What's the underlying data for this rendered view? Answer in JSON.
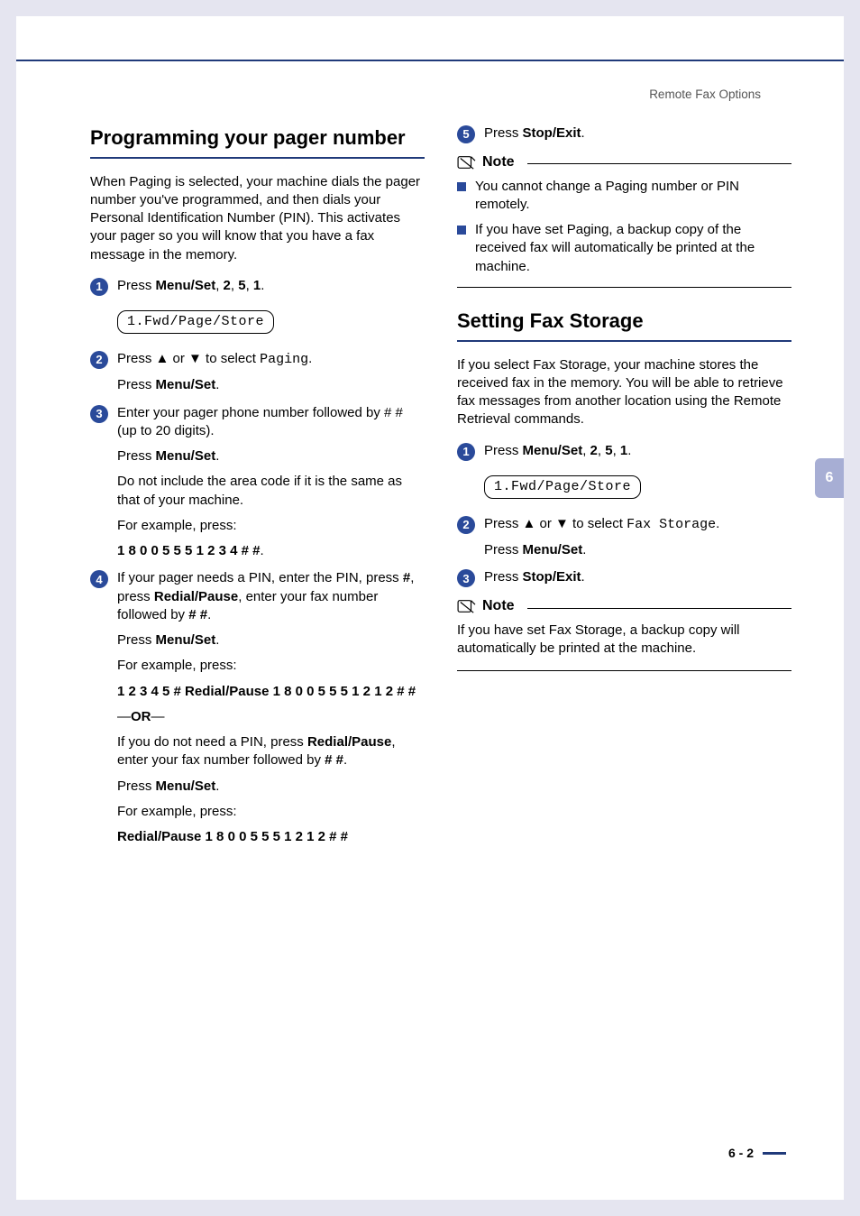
{
  "header": {
    "section": "Remote Fax Options"
  },
  "tab": {
    "chapter": "6"
  },
  "footer": {
    "page": "6 - 2"
  },
  "left": {
    "h1": "Programming your pager number",
    "intro": "When Paging is selected, your machine dials the pager number you've programmed, and then dials your Personal Identification Number (PIN). This activates your pager so you will know that you have a fax message in the memory.",
    "s1": {
      "pre": "Press ",
      "b1": "Menu/Set",
      "mid1": ", ",
      "b2": "2",
      "mid2": ", ",
      "b3": "5",
      "mid3": ", ",
      "b4": "1",
      "end": "."
    },
    "lcd1": "1.Fwd/Page/Store",
    "s2": {
      "line1_pre": "Press ▲ or ▼ to select ",
      "line1_mono": "Paging",
      "line1_end": ".",
      "line2_pre": "Press ",
      "line2_b": "Menu/Set",
      "line2_end": "."
    },
    "s3": {
      "p1": "Enter your pager phone number followed by # # (up to 20 digits).",
      "p2_pre": "Press ",
      "p2_b": "Menu/Set",
      "p2_end": ".",
      "p3": "Do not include the area code if it is the same as that of your machine.",
      "p4": "For example, press:",
      "p5": "1 8 0 0 5 5 5 1 2 3 4 # #",
      "p5_end": "."
    },
    "s4": {
      "p1_a": "If your pager needs a PIN, enter the PIN, press ",
      "p1_b1": "#",
      "p1_c": ", press ",
      "p1_b2": "Redial/Pause",
      "p1_d": ", enter your fax number followed by ",
      "p1_b3": "# #",
      "p1_e": ".",
      "p2_pre": "Press ",
      "p2_b": "Menu/Set",
      "p2_end": ".",
      "p3": "For example, press:",
      "p4": "1 2 3 4 5 # Redial/Pause 1 8 0 0 5 5 5 1 2 1 2 # #",
      "or_pre": "—",
      "or_b": "OR",
      "or_post": "—",
      "p5_a": "If you do not need a PIN, press ",
      "p5_b1": "Redial/Pause",
      "p5_c": ", enter your fax number followed by ",
      "p5_b2": "# #",
      "p5_d": ".",
      "p6_pre": "Press ",
      "p6_b": "Menu/Set",
      "p6_end": ".",
      "p7": "For example, press:",
      "p8": "Redial/Pause 1 8 0 0 5 5 5 1 2 1 2 # #"
    }
  },
  "right": {
    "s5": {
      "pre": "Press ",
      "b": "Stop/Exit",
      "end": "."
    },
    "note1": {
      "label": "Note",
      "b1": "You cannot change a Paging number or PIN remotely.",
      "b2": "If you have set Paging, a backup copy of the received fax will automatically be printed at the machine."
    },
    "h2": "Setting Fax Storage",
    "intro2": "If you select Fax Storage, your machine stores the received fax in the memory. You will be able to retrieve fax messages from another location using the Remote Retrieval commands.",
    "r1": {
      "pre": "Press ",
      "b1": "Menu/Set",
      "mid1": ", ",
      "b2": "2",
      "mid2": ", ",
      "b3": "5",
      "mid3": ", ",
      "b4": "1",
      "end": "."
    },
    "lcd2": "1.Fwd/Page/Store",
    "r2": {
      "line1_pre": "Press ▲ or ▼ to select ",
      "line1_mono": "Fax Storage",
      "line1_end": ".",
      "line2_pre": "Press ",
      "line2_b": "Menu/Set",
      "line2_end": "."
    },
    "r3": {
      "pre": "Press ",
      "b": "Stop/Exit",
      "end": "."
    },
    "note2": {
      "label": "Note",
      "text": "If you have set Fax Storage, a backup copy will automatically be printed at the machine."
    }
  }
}
